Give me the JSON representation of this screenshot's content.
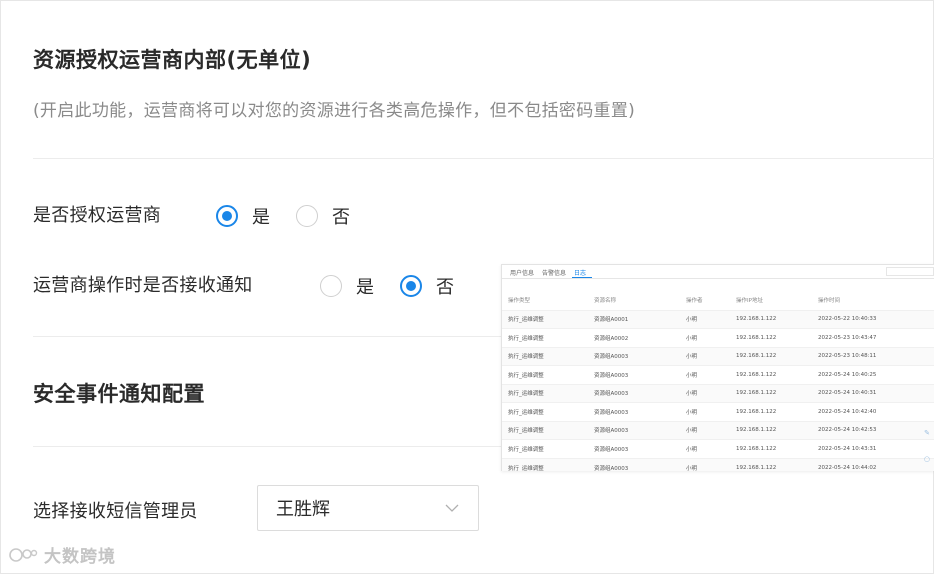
{
  "section1": {
    "title": "资源授权运营商内部(无单位)",
    "description": "(开启此功能，运营商将可以对您的资源进行各类高危操作，但不包括密码重置)"
  },
  "authorize": {
    "label": "是否授权运营商",
    "options": [
      {
        "label": "是",
        "checked": true
      },
      {
        "label": "否",
        "checked": false
      }
    ]
  },
  "notify_on_operation": {
    "label": "运营商操作时是否接收通知",
    "options": [
      {
        "label": "是",
        "checked": false
      },
      {
        "label": "否",
        "checked": true
      }
    ]
  },
  "section2": {
    "title": "安全事件通知配置"
  },
  "sms_admin": {
    "label": "选择接收短信管理员",
    "selected": "王胜辉"
  },
  "embedded_table": {
    "tabs": [
      "用户信息",
      "告警信息",
      "日志"
    ],
    "active_tab": 2,
    "columns": [
      "操作类型",
      "资源名称",
      "操作者",
      "操作IP地址",
      "操作时间"
    ],
    "rows": [
      [
        "执行_运维调整",
        "资源组A0001",
        "小明",
        "192.168.1.122",
        "2022-05-22 10:40:33"
      ],
      [
        "执行_运维调整",
        "资源组A0002",
        "小明",
        "192.168.1.122",
        "2022-05-23 10:43:47"
      ],
      [
        "执行_运维调整",
        "资源组A0003",
        "小明",
        "192.168.1.122",
        "2022-05-23 10:48:11"
      ],
      [
        "执行_运维调整",
        "资源组A0003",
        "小明",
        "192.168.1.122",
        "2022-05-24 10:40:25"
      ],
      [
        "执行_运维调整",
        "资源组A0003",
        "小明",
        "192.168.1.122",
        "2022-05-24 10:40:31"
      ],
      [
        "执行_运维调整",
        "资源组A0003",
        "小明",
        "192.168.1.122",
        "2022-05-24 10:42:40"
      ],
      [
        "执行_运维调整",
        "资源组A0003",
        "小明",
        "192.168.1.122",
        "2022-05-24 10:42:53"
      ],
      [
        "执行_运维调整",
        "资源组A0003",
        "小明",
        "192.168.1.122",
        "2022-05-24 10:43:31"
      ],
      [
        "执行_运维调整",
        "资源组A0003",
        "小明",
        "192.168.1.122",
        "2022-05-24 10:44:02"
      ]
    ]
  },
  "watermark": {
    "text": "大数跨境"
  },
  "colors": {
    "accent": "#1a86e8",
    "description_text": "#8a8a8a",
    "divider": "#ececec"
  }
}
